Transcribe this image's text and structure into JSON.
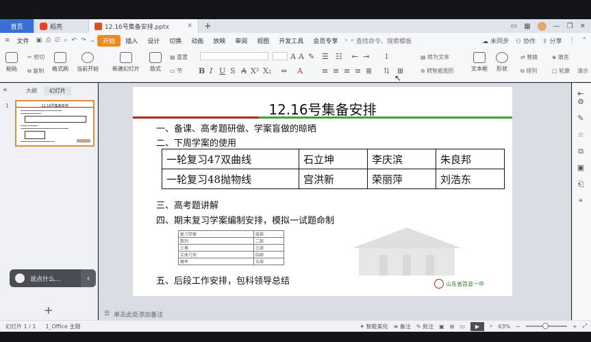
{
  "tabs": {
    "home": "首页",
    "straw": "稻壳",
    "file": "12.16号集备安排.pptx",
    "new_tab": "+"
  },
  "menu": {
    "file": "文件",
    "items": [
      "开始",
      "插入",
      "设计",
      "切换",
      "动画",
      "放映",
      "审阅",
      "视图",
      "开发工具",
      "会员专享"
    ],
    "search": "查找命令、搜索模板",
    "right": [
      "未同步",
      "协作",
      "分享"
    ]
  },
  "ribbon": {
    "paste": "粘贴",
    "cut": "剪切",
    "copy": "复制",
    "format_painter": "格式刷",
    "play_current": "当前开始",
    "new_slide": "新建幻灯片",
    "layout": "版式",
    "section": "节",
    "reset": "重置",
    "textbox": "文本框",
    "shape": "形状",
    "arrange": "排列",
    "draw": "绘制",
    "replace": "替换",
    "select": "选择",
    "fill": "填充",
    "outline": "轮廓",
    "play": "演示",
    "convert": "转智能图形",
    "text_to": "转为文本"
  },
  "left_panel": {
    "tab_outline": "大纲",
    "tab_slides": "幻灯片",
    "slide_number": "1",
    "chat_placeholder": "说点什么...",
    "add": "+"
  },
  "slide": {
    "title": "12.16号集备安排",
    "item1": "一、备课、高考题研做、学案盲做的晾晒",
    "item2": "二、下周学案的使用",
    "table_rows": [
      [
        "一轮复习47双曲线",
        "石立坤",
        "李庆滨",
        "朱良邦"
      ],
      [
        "一轮复习48抛物线",
        "宫洪新",
        "荣丽萍",
        "刘浩东"
      ]
    ],
    "item3": "三、高考题讲解",
    "item4": "四、期末复习学案编制安排，模拟一试题命制",
    "small_table": [
      [
        "复习学案",
        "级部"
      ],
      [
        "数列",
        "二部"
      ],
      [
        "三角",
        "三部"
      ],
      [
        "立体几何",
        "四部"
      ],
      [
        "概率",
        "五部"
      ]
    ],
    "item5": "五、后段工作安排，包科领导总结",
    "school_logo_text": "山东省莒县一中"
  },
  "notes_placeholder": "单击此处添加备注",
  "status": {
    "slide_count": "幻灯片 1 / 1",
    "theme": "1_Office 主题",
    "smart": "智能美化",
    "notes": "备注",
    "comment": "批注",
    "zoom": "63%"
  },
  "colors": {
    "accent_orange": "#f08a1c",
    "title_red_line": "#b3261e",
    "title_green_line": "#3aa63a"
  }
}
